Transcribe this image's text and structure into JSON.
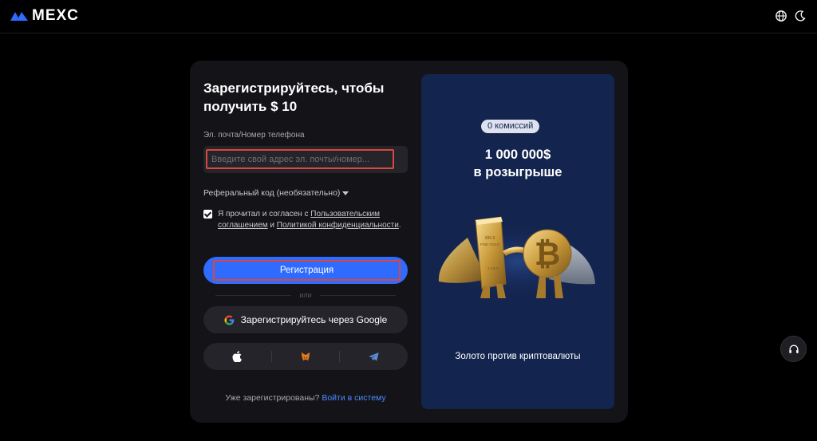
{
  "header": {
    "logo_text": "MEXC",
    "icons": [
      "globe-icon",
      "moon-icon"
    ]
  },
  "form": {
    "title": "Зарегистрируйтесь, чтобы получить $ 10",
    "email_label": "Эл. почта/Номер телефона",
    "email_placeholder": "Введите свой адрес эл. почты/номер...",
    "email_value": "",
    "referral_label": "Реферальный код (необязательно)",
    "agree_prefix": "Я прочитал и согласен с",
    "terms_link": "Пользовательским соглашением",
    "agree_and": "и",
    "privacy_link": "Политикой конфиденциальности",
    "agree_suffix": ".",
    "agree_checked": true,
    "register_button": "Регистрация",
    "or_text": "или",
    "google_button": "Зарегистрируйтесь через Google",
    "social_icons": [
      "apple-icon",
      "metamask-icon",
      "telegram-icon"
    ],
    "login_prompt": "Уже зарегистрированы?",
    "login_link": "Войти в систему"
  },
  "promo": {
    "badge": "0 комиссий",
    "amount": "1 000 000$",
    "subtitle": "в розыгрыше",
    "caption": "Золото против криптовалюты",
    "art_labels": [
      "999.9",
      "FINE GOLD",
      "1 KILO"
    ]
  },
  "colors": {
    "accent": "#2f6bff",
    "highlight": "#d7483e",
    "promo_bg": "#13244e"
  }
}
